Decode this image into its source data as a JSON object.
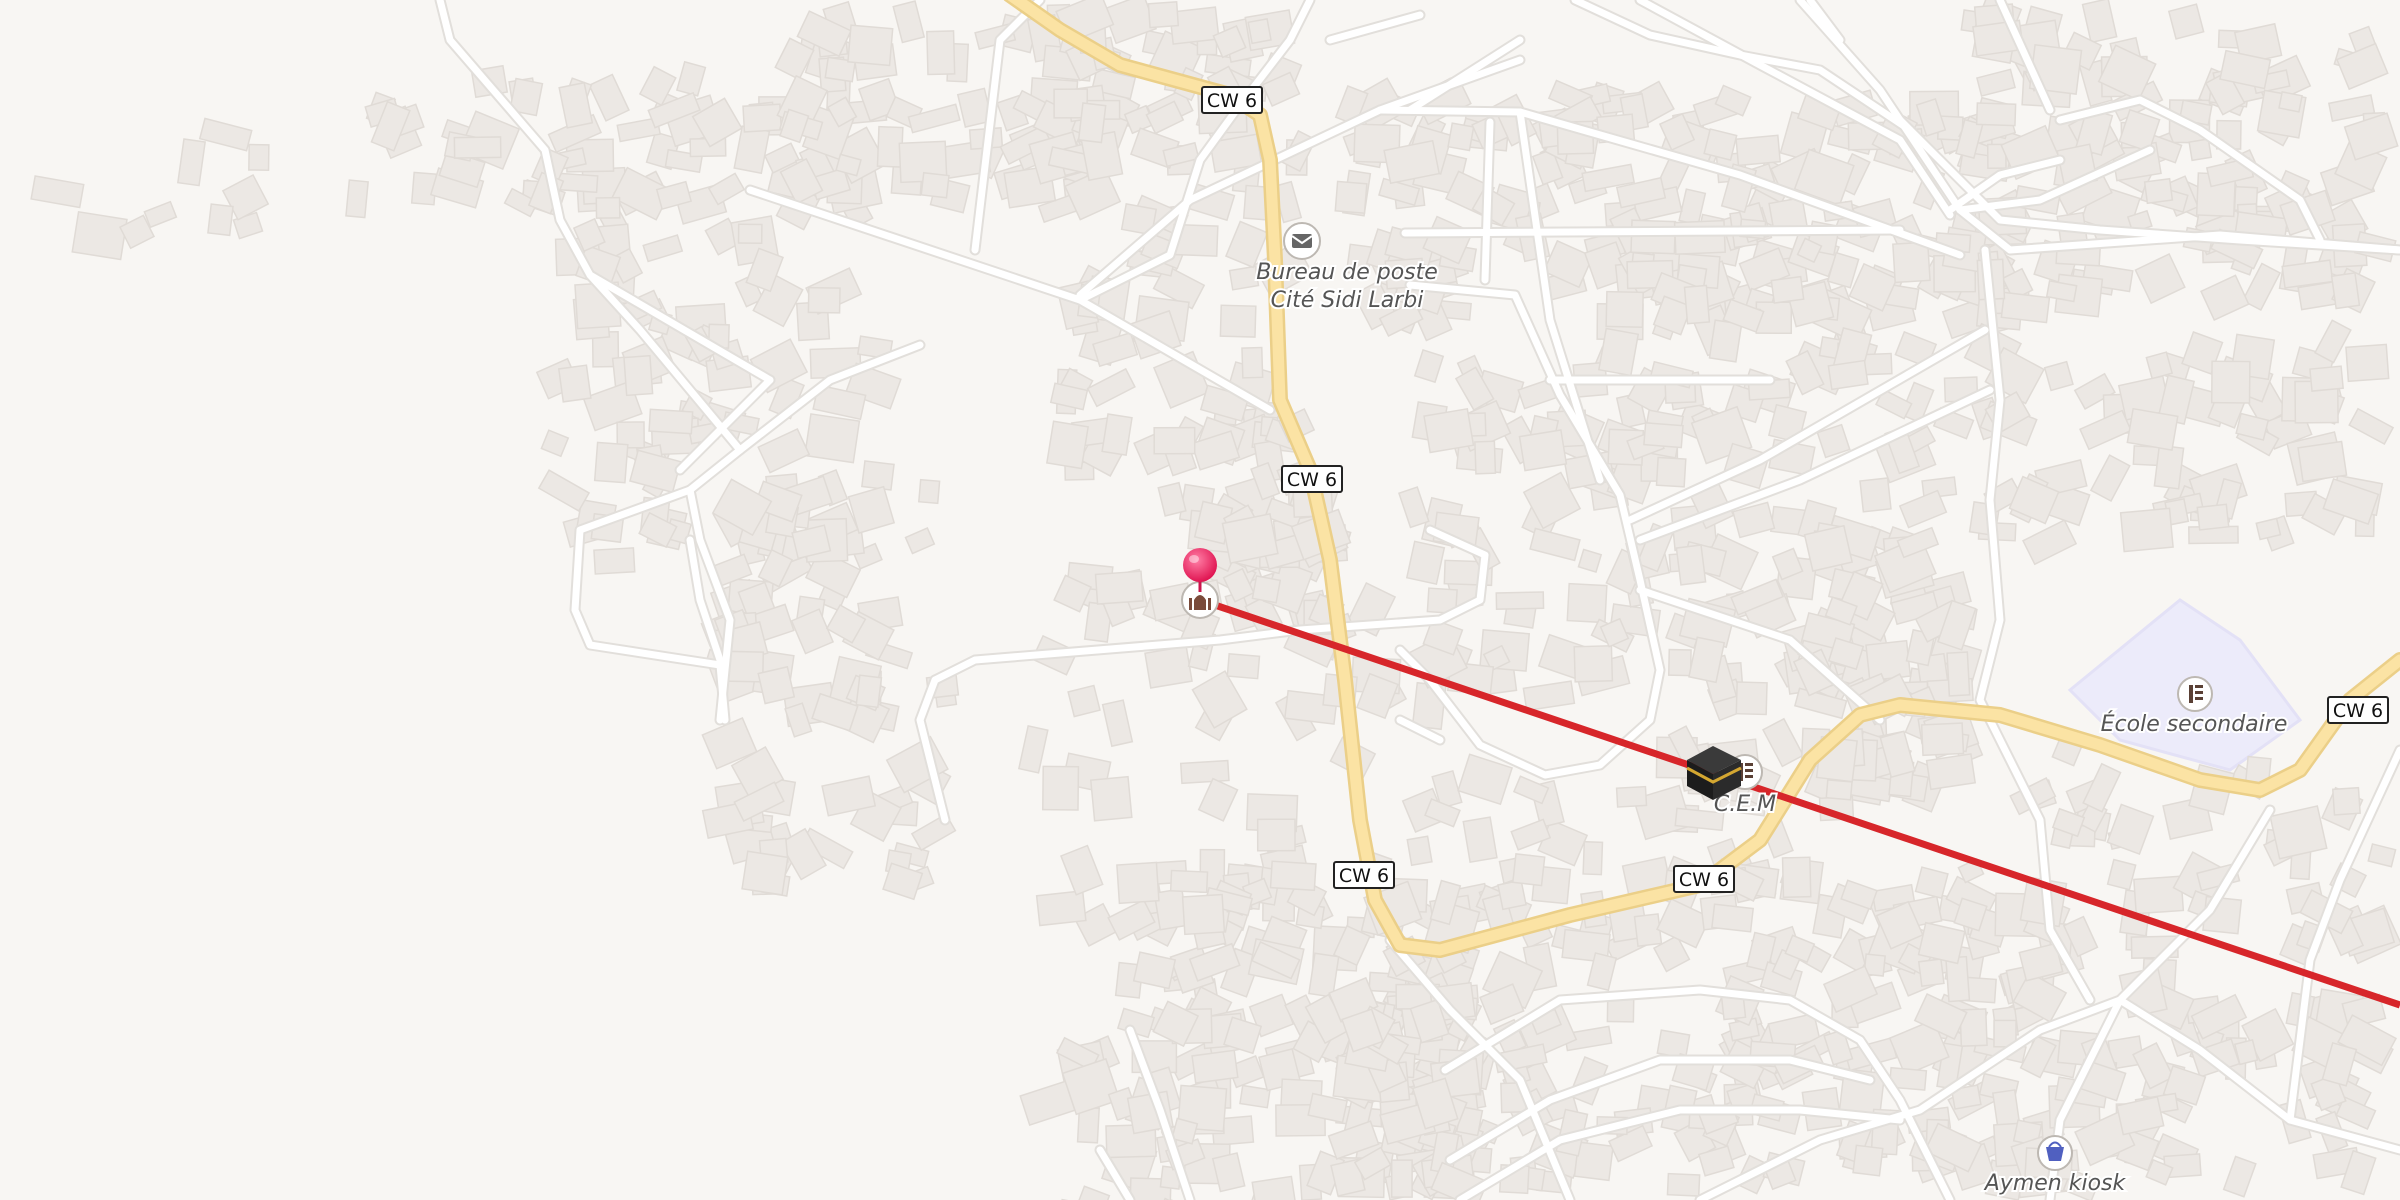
{
  "map": {
    "road_shields": [
      {
        "id": "shield-1",
        "text": "CW 6"
      },
      {
        "id": "shield-2",
        "text": "CW 6"
      },
      {
        "id": "shield-3",
        "text": "CW 6"
      },
      {
        "id": "shield-4",
        "text": "CW 6"
      },
      {
        "id": "shield-5",
        "text": "CW 6"
      }
    ],
    "pois": [
      {
        "id": "post-office",
        "icon": "envelope-icon",
        "label_line1": "Bureau de poste",
        "label_line2": "Cité Sidi Larbi"
      },
      {
        "id": "mosque",
        "icon": "mosque-icon"
      },
      {
        "id": "kaaba",
        "icon": "kaaba-icon"
      },
      {
        "id": "cem",
        "icon": "school-icon",
        "label": "C.E.M"
      },
      {
        "id": "ecole",
        "icon": "school-icon",
        "label": "École secondaire"
      },
      {
        "id": "kiosk",
        "icon": "shopping-basket-icon",
        "label": "Aymen kiosk"
      }
    ],
    "pin": {
      "icon": "location-pin-icon",
      "color": "#e91e63"
    },
    "qibla_line": {
      "color": "#d7262a"
    },
    "colors": {
      "background": "#f8f6f3",
      "building": "#ece8e4",
      "building_edge": "#e0dbd6",
      "road": "#ffffff",
      "road_casing": "#e2dfdb",
      "main_road": "#fbe3a4",
      "main_road_casing": "#ebcf88",
      "school_area": "#ecebfa",
      "label": "#555555"
    }
  }
}
